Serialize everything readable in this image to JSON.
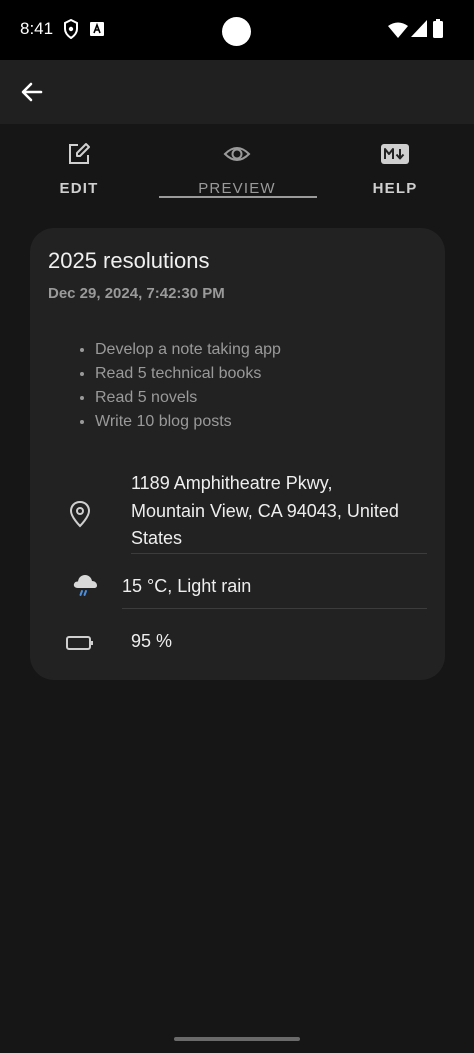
{
  "status_bar": {
    "time": "8:41",
    "icons_left": [
      "shield-icon",
      "a-box-icon"
    ],
    "icons_right": [
      "wifi-icon",
      "signal-icon",
      "battery-icon"
    ]
  },
  "app_bar": {
    "back_icon": "arrow-left-icon"
  },
  "tabs": [
    {
      "label": "EDIT",
      "icon": "edit-square-icon",
      "selected": false
    },
    {
      "label": "PREVIEW",
      "icon": "eye-icon",
      "selected": true
    },
    {
      "label": "HELP",
      "icon": "markdown-icon",
      "selected": false
    }
  ],
  "note": {
    "title": "2025 resolutions",
    "date": "Dec 29, 2024, 7:42:30 PM",
    "items": [
      "Develop a note taking app",
      "Read 5 technical books",
      "Read 5 novels",
      "Write 10 blog posts"
    ],
    "location": {
      "line1": "1189 Amphitheatre Pkwy,",
      "line2": "Mountain View, CA 94043, United",
      "line3": "States",
      "icon": "location-pin-icon"
    },
    "weather": {
      "text": "15 °C, Light rain",
      "icon": "rain-cloud-icon"
    },
    "battery": {
      "text": "95 %",
      "icon": "battery-icon"
    }
  },
  "colors": {
    "background": "#161616",
    "status_bar": "#000000",
    "app_bar": "#202020",
    "card": "#222222",
    "rain_accent": "#4a90e2"
  }
}
